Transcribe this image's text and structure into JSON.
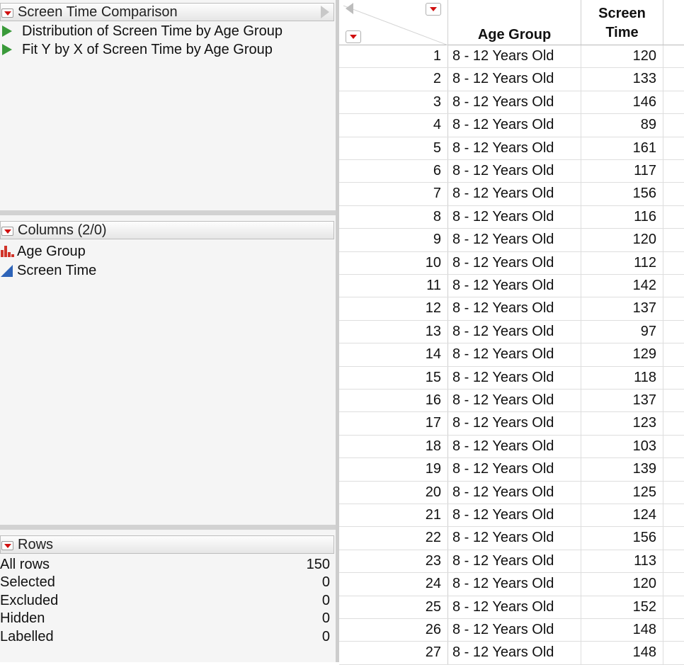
{
  "table_panel": {
    "title": "Screen Time Comparison",
    "scripts": [
      "Distribution of Screen Time by Age Group",
      "Fit Y by X of Screen Time by Age Group"
    ]
  },
  "columns_panel": {
    "title": "Columns (2/0)",
    "columns": [
      {
        "name": "Age Group",
        "icon": "nominal-bar-icon"
      },
      {
        "name": "Screen Time",
        "icon": "continuous-triangle-icon"
      }
    ]
  },
  "rows_panel": {
    "title": "Rows",
    "stats": [
      {
        "label": "All rows",
        "value": "150"
      },
      {
        "label": "Selected",
        "value": "0"
      },
      {
        "label": "Excluded",
        "value": "0"
      },
      {
        "label": "Hidden",
        "value": "0"
      },
      {
        "label": "Labelled",
        "value": "0"
      }
    ]
  },
  "grid": {
    "headers": {
      "age_group": "Age Group",
      "screen_time_line1": "Screen",
      "screen_time_line2": "Time"
    },
    "rows": [
      {
        "n": "1",
        "age": "8 - 12 Years Old",
        "st": "120"
      },
      {
        "n": "2",
        "age": "8 - 12 Years Old",
        "st": "133"
      },
      {
        "n": "3",
        "age": "8 - 12 Years Old",
        "st": "146"
      },
      {
        "n": "4",
        "age": "8 - 12 Years Old",
        "st": "89"
      },
      {
        "n": "5",
        "age": "8 - 12 Years Old",
        "st": "161"
      },
      {
        "n": "6",
        "age": "8 - 12 Years Old",
        "st": "117"
      },
      {
        "n": "7",
        "age": "8 - 12 Years Old",
        "st": "156"
      },
      {
        "n": "8",
        "age": "8 - 12 Years Old",
        "st": "116"
      },
      {
        "n": "9",
        "age": "8 - 12 Years Old",
        "st": "120"
      },
      {
        "n": "10",
        "age": "8 - 12 Years Old",
        "st": "112"
      },
      {
        "n": "11",
        "age": "8 - 12 Years Old",
        "st": "142"
      },
      {
        "n": "12",
        "age": "8 - 12 Years Old",
        "st": "137"
      },
      {
        "n": "13",
        "age": "8 - 12 Years Old",
        "st": "97"
      },
      {
        "n": "14",
        "age": "8 - 12 Years Old",
        "st": "129"
      },
      {
        "n": "15",
        "age": "8 - 12 Years Old",
        "st": "118"
      },
      {
        "n": "16",
        "age": "8 - 12 Years Old",
        "st": "137"
      },
      {
        "n": "17",
        "age": "8 - 12 Years Old",
        "st": "123"
      },
      {
        "n": "18",
        "age": "8 - 12 Years Old",
        "st": "103"
      },
      {
        "n": "19",
        "age": "8 - 12 Years Old",
        "st": "139"
      },
      {
        "n": "20",
        "age": "8 - 12 Years Old",
        "st": "125"
      },
      {
        "n": "21",
        "age": "8 - 12 Years Old",
        "st": "124"
      },
      {
        "n": "22",
        "age": "8 - 12 Years Old",
        "st": "156"
      },
      {
        "n": "23",
        "age": "8 - 12 Years Old",
        "st": "113"
      },
      {
        "n": "24",
        "age": "8 - 12 Years Old",
        "st": "120"
      },
      {
        "n": "25",
        "age": "8 - 12 Years Old",
        "st": "152"
      },
      {
        "n": "26",
        "age": "8 - 12 Years Old",
        "st": "148"
      },
      {
        "n": "27",
        "age": "8 - 12 Years Old",
        "st": "148"
      }
    ]
  },
  "colors": {
    "menu_triangle": "#d01010",
    "script_triangle": "#3a9a3a",
    "nominal_icon": "#d0342a",
    "continuous_icon": "#2d63b8"
  }
}
